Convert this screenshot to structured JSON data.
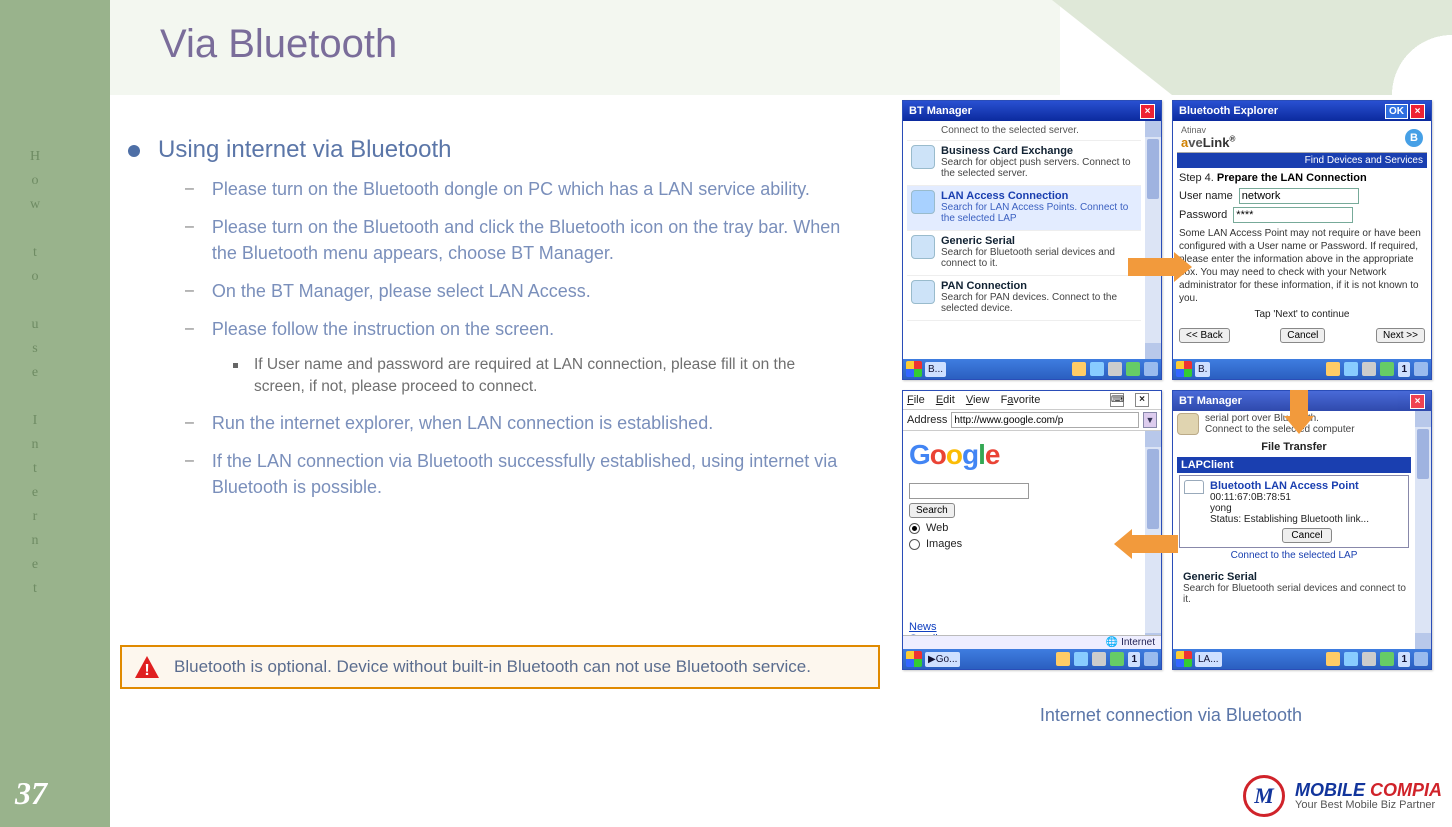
{
  "page": {
    "title": "Via Bluetooth",
    "number": "37",
    "vertical_label": "How to use Internet",
    "caption": "Internet connection via Bluetooth"
  },
  "bullets": {
    "main": "Using internet via Bluetooth",
    "subs": [
      "Please turn on the Bluetooth dongle on PC which has a LAN service ability.",
      "Please turn on the Bluetooth and click the Bluetooth icon on the tray bar. When the Bluetooth menu appears, choose BT Manager.",
      "On the BT Manager, please select LAN Access.",
      "Please follow the instruction on the screen.",
      "Run the internet explorer, when LAN connection is established.",
      "If the LAN connection via Bluetooth successfully established, using internet via Bluetooth is possible."
    ],
    "subsub": "If User name and password are required at LAN connection, please fill it on the screen, if not, please proceed to connect."
  },
  "warning": "Bluetooth is optional. Device without built-in Bluetooth can not use Bluetooth service.",
  "branding": {
    "name": "MOBILE COMPIA",
    "tagline": "Your Best Mobile Biz Partner"
  },
  "shot1": {
    "title": "BT Manager",
    "top_line": "Connect to the selected server.",
    "items": [
      {
        "title": "Business Card Exchange",
        "desc": "Search for object push servers. Connect to the selected server."
      },
      {
        "title": "LAN Access Connection",
        "desc": "Search for LAN Access Points. Connect to the selected LAP"
      },
      {
        "title": "Generic Serial",
        "desc": "Search for Bluetooth serial devices  and connect to it."
      },
      {
        "title": "PAN Connection",
        "desc": "Search for PAN devices. Connect to the selected device."
      }
    ],
    "task_chip": "B..."
  },
  "shot2": {
    "title": "Bluetooth Explorer",
    "ok": "OK",
    "logo_prefix": "Atinav",
    "subbar": "Find Devices and Services",
    "step": "Step 4.",
    "step_bold": "Prepare the LAN Connection",
    "labels": {
      "user": "User name",
      "pass": "Password"
    },
    "values": {
      "user": "network",
      "pass": "****"
    },
    "hint": "Some LAN Access Point may not require or have been configured with a User name or Password.  If required, please enter the information above in the appropriate box. You may need to check with your Network administrator for these information, if it is not known to you.",
    "tap": "Tap 'Next' to continue",
    "buttons": {
      "back": "<< Back",
      "cancel": "Cancel",
      "next": "Next >>"
    },
    "task_chip": "B."
  },
  "shot3": {
    "menus": {
      "file": "File",
      "edit": "Edit",
      "view": "View",
      "fav": "Favorite"
    },
    "address_label": "Address",
    "address_value": "http://www.google.com/p",
    "search_btn": "Search",
    "radios": {
      "web": "Web",
      "images": "Images"
    },
    "links": {
      "news": "News",
      "gmail": "Gmail"
    },
    "status": "Internet",
    "task_chip": "Go..."
  },
  "shot4": {
    "title": "BT Manager",
    "top_desc1": "serial port over Bluetooth.",
    "top_desc2": "Connect to the selected computer",
    "section": "File Transfer",
    "lap": "LAPClient",
    "ap": {
      "title": "Bluetooth LAN Access Point",
      "mac": "00:11:67:0B:78:51",
      "name": "yong",
      "status": "Status: Establishing Bluetooth link...",
      "cancel": "Cancel"
    },
    "connect_line": "Connect to the selected LAP",
    "gs_title": "Generic Serial",
    "gs_desc": "Search for Bluetooth serial devices  and connect to it.",
    "task_chip": "LA..."
  }
}
